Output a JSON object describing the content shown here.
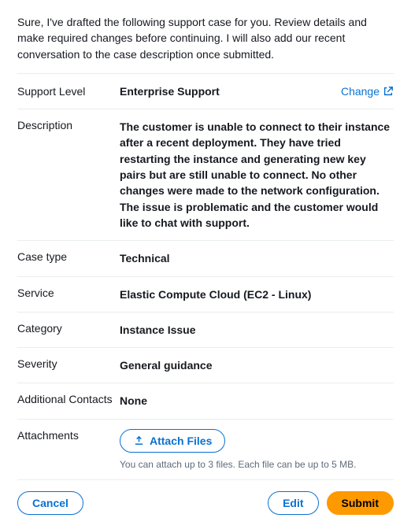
{
  "intro": "Sure, I've drafted the following support case for you. Review details and make required changes before continuing. I will also add our recent conversation to the case description once submitted.",
  "changeLabel": "Change",
  "fields": {
    "supportLevel": {
      "label": "Support Level",
      "value": "Enterprise Support"
    },
    "description": {
      "label": "Description",
      "value": "The customer is unable to connect to their instance after a recent deployment. They have tried restarting the instance and generating new key pairs but are still unable to connect. No other changes were made to the network configuration. The issue is problematic and the customer would like to chat with support."
    },
    "caseType": {
      "label": "Case type",
      "value": "Technical"
    },
    "service": {
      "label": "Service",
      "value": "Elastic Compute Cloud (EC2 - Linux)"
    },
    "category": {
      "label": "Category",
      "value": "Instance Issue"
    },
    "severity": {
      "label": "Severity",
      "value": "General guidance"
    },
    "additionalContacts": {
      "label": "Additional Contacts",
      "value": "None"
    },
    "attachments": {
      "label": "Attachments",
      "buttonLabel": "Attach Files",
      "hint": "You can attach up to 3 files. Each file can be up to 5 MB."
    }
  },
  "actions": {
    "cancel": "Cancel",
    "edit": "Edit",
    "submit": "Submit"
  }
}
